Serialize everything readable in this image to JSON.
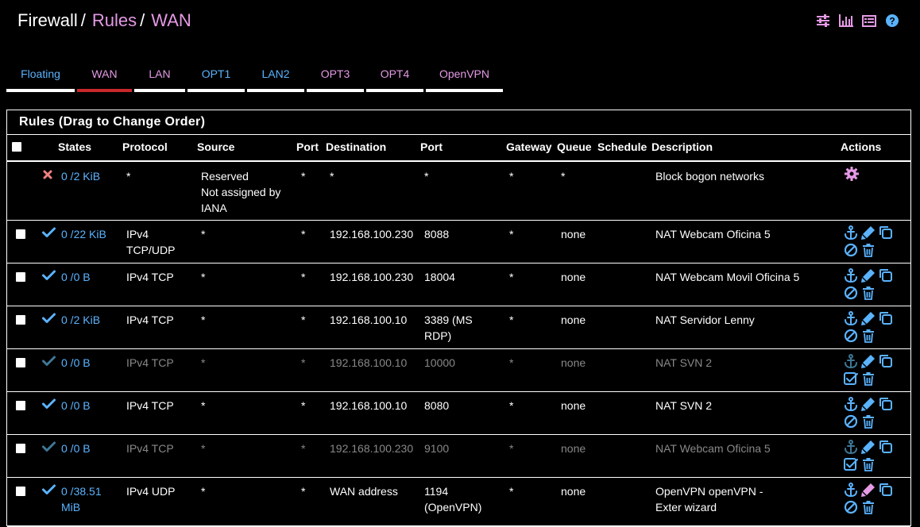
{
  "breadcrumb": {
    "root": "Firewall",
    "sep": "/",
    "part1": "Rules",
    "part2": "WAN"
  },
  "header_icons": [
    "sliders-icon",
    "bar-chart-icon",
    "list-icon",
    "help-icon"
  ],
  "tabs": [
    {
      "label": "Floating",
      "active": false
    },
    {
      "label": "WAN",
      "active": true
    },
    {
      "label": "LAN",
      "active": false
    },
    {
      "label": "OPT1",
      "active": false
    },
    {
      "label": "LAN2",
      "active": false
    },
    {
      "label": "OPT3",
      "active": false
    },
    {
      "label": "OPT4",
      "active": false
    },
    {
      "label": "OpenVPN",
      "active": false
    }
  ],
  "panel": {
    "title": "Rules (Drag to Change Order)",
    "columns": [
      "States",
      "Protocol",
      "Source",
      "Port",
      "Destination",
      "Port",
      "Gateway",
      "Queue",
      "Schedule",
      "Description",
      "Actions"
    ]
  },
  "rows": [
    {
      "status": "block",
      "states": [
        "0 /2 KiB"
      ],
      "protocol": [
        "*"
      ],
      "source": [
        "Reserved",
        "Not assigned by",
        "IANA"
      ],
      "sport": "*",
      "destination": "*",
      "dport": [
        "*"
      ],
      "gateway": "*",
      "queue": "*",
      "description": [
        "Block bogon networks"
      ],
      "disabled": false,
      "checkbox": false
    },
    {
      "status": "pass",
      "states": [
        "0 /22 KiB"
      ],
      "protocol": [
        "IPv4",
        "TCP/UDP"
      ],
      "source": [
        "*"
      ],
      "sport": "*",
      "destination": "192.168.100.230",
      "dport": [
        "8088"
      ],
      "gateway": "*",
      "queue": "none",
      "description": [
        "NAT Webcam Oficina 5"
      ],
      "disabled": false,
      "checkbox": true
    },
    {
      "status": "pass",
      "states": [
        "0 /0 B"
      ],
      "protocol": [
        "IPv4 TCP"
      ],
      "source": [
        "*"
      ],
      "sport": "*",
      "destination": "192.168.100.230",
      "dport": [
        "18004"
      ],
      "gateway": "*",
      "queue": "none",
      "description": [
        "NAT Webcam Movil Oficina 5"
      ],
      "disabled": false,
      "checkbox": true
    },
    {
      "status": "pass",
      "states": [
        "0 /2 KiB"
      ],
      "protocol": [
        "IPv4 TCP"
      ],
      "source": [
        "*"
      ],
      "sport": "*",
      "destination": "192.168.100.10",
      "dport": [
        "3389 (MS",
        "RDP)"
      ],
      "gateway": "*",
      "queue": "none",
      "description": [
        "NAT Servidor Lenny"
      ],
      "disabled": false,
      "checkbox": true
    },
    {
      "status": "pass",
      "states": [
        "0 /0 B"
      ],
      "protocol": [
        "IPv4 TCP"
      ],
      "source": [
        "*"
      ],
      "sport": "*",
      "destination": "192.168.100.10",
      "dport": [
        "10000"
      ],
      "gateway": "*",
      "queue": "none",
      "description": [
        "NAT SVN 2"
      ],
      "disabled": true,
      "checkbox": true
    },
    {
      "status": "pass",
      "states": [
        "0 /0 B"
      ],
      "protocol": [
        "IPv4 TCP"
      ],
      "source": [
        "*"
      ],
      "sport": "*",
      "destination": "192.168.100.10",
      "dport": [
        "8080"
      ],
      "gateway": "*",
      "queue": "none",
      "description": [
        "NAT SVN 2"
      ],
      "disabled": false,
      "checkbox": true
    },
    {
      "status": "pass",
      "states": [
        "0 /0 B"
      ],
      "protocol": [
        "IPv4 TCP"
      ],
      "source": [
        "*"
      ],
      "sport": "*",
      "destination": "192.168.100.230",
      "dport": [
        "9100"
      ],
      "gateway": "*",
      "queue": "none",
      "description": [
        "NAT Webcam Oficina 5"
      ],
      "disabled": true,
      "checkbox": true
    },
    {
      "status": "pass",
      "states": [
        "0 /38.51",
        "MiB"
      ],
      "protocol": [
        "IPv4 UDP"
      ],
      "source": [
        "*"
      ],
      "sport": "*",
      "destination": "WAN address",
      "dport": [
        "1194",
        "(OpenVPN)"
      ],
      "gateway": "*",
      "queue": "none",
      "description": [
        "OpenVPN openVPN -",
        "Exter wizard"
      ],
      "disabled": false,
      "checkbox": true
    }
  ],
  "colors": {
    "link": "#5bb3ff",
    "pink": "#e59ae5",
    "active_tab_border": "#c8282c",
    "block": "#f08080",
    "dim": "#888888"
  }
}
